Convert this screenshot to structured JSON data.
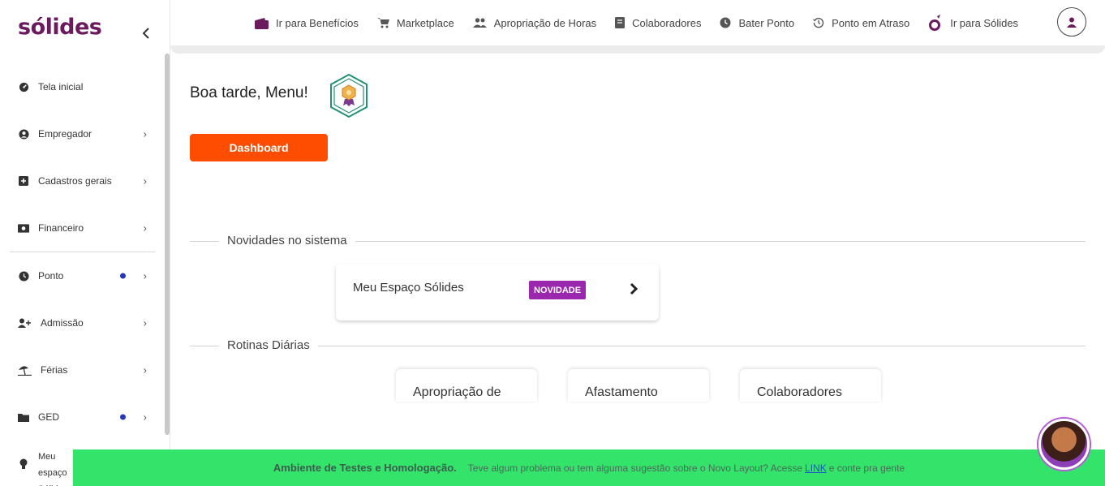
{
  "app": {
    "logo_text": "sólides"
  },
  "sidebar": {
    "items": [
      {
        "label": "Tela inicial",
        "icon": "dashboard-icon",
        "has_arrow": false
      },
      {
        "label": "Empregador",
        "icon": "user-circle-icon",
        "has_arrow": true
      },
      {
        "label": "Cadastros gerais",
        "icon": "plus-square-icon",
        "has_arrow": true
      },
      {
        "label": "Financeiro",
        "icon": "money-icon",
        "has_arrow": true
      },
      {
        "label": "Ponto",
        "icon": "clock-icon",
        "has_arrow": true,
        "dot": true
      },
      {
        "label": "Admissão",
        "icon": "add-user-icon",
        "has_arrow": true
      },
      {
        "label": "Férias",
        "icon": "umbrella-beach-icon",
        "has_arrow": true
      },
      {
        "label": "GED",
        "icon": "folder-icon",
        "has_arrow": true,
        "dot": true
      },
      {
        "label": "Meu espaço Sólides",
        "icon": "lightbulb-icon",
        "has_arrow": false
      }
    ]
  },
  "topbar": {
    "links": [
      {
        "label": "Ir para Benefícios",
        "icon": "wallet-icon"
      },
      {
        "label": "Marketplace",
        "icon": "cart-icon"
      },
      {
        "label": "Apropriação de Horas",
        "icon": "people-icon"
      },
      {
        "label": "Colaboradores",
        "icon": "book-icon"
      },
      {
        "label": "Bater Ponto",
        "icon": "clock-icon"
      },
      {
        "label": "Ponto em Atraso",
        "icon": "history-icon"
      },
      {
        "label": "Ir para Sólides",
        "icon": "solides-logo-icon"
      }
    ]
  },
  "main": {
    "greeting": "Boa tarde, Menu!",
    "dashboard_button": "Dashboard",
    "news_section_title": "Novidades no sistema",
    "news_card": {
      "title": "Meu Espaço Sólides",
      "tag": "NOVIDADE"
    },
    "routines_section_title": "Rotinas Diárias",
    "routines": [
      "Apropriação de",
      "Afastamento",
      "Colaboradores"
    ]
  },
  "banner": {
    "title": "Ambiente de Testes e Homologação.",
    "text_before": "Teve algum problema ou tem alguma sugestão sobre o Novo Layout? Acesse",
    "link": "LINK",
    "text_after": "e conte pra gente"
  },
  "colors": {
    "brand": "#6b1a5e",
    "dashboard_button": "#ff4d00",
    "news_tag": "#9b27af",
    "banner": "#33e36a",
    "nav_dot": "#2636b8"
  }
}
